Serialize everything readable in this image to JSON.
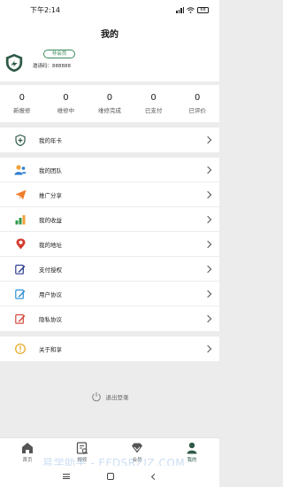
{
  "status_bar": {
    "time": "下午2:14",
    "battery": "68"
  },
  "header": {
    "title": "我的"
  },
  "profile": {
    "member_badge": "非会员",
    "invite_code": "邀请码：888888"
  },
  "stats": [
    {
      "value": "0",
      "label": "新报修"
    },
    {
      "value": "0",
      "label": "维修中"
    },
    {
      "value": "0",
      "label": "维修完成"
    },
    {
      "value": "0",
      "label": "已支付"
    },
    {
      "value": "0",
      "label": "已评价"
    }
  ],
  "menu": {
    "annual_card": "我的年卡",
    "team": "我的团队",
    "share": "推广分享",
    "income": "我的收益",
    "address": "我的地址",
    "payment_auth": "支付授权",
    "user_agreement": "用户协议",
    "privacy_policy": "隐私协议",
    "about": "关于和享"
  },
  "logout": {
    "label": "退出登录"
  },
  "tabbar": [
    {
      "label": "首页"
    },
    {
      "label": "报修"
    },
    {
      "label": "会员"
    },
    {
      "label": "我的"
    }
  ],
  "watermark": "易学助手 - EFDSRZJZ.COM",
  "colors": {
    "brand_green": "#2d5a46",
    "badge_green": "#3a8a5a",
    "page_bg": "#ececec"
  }
}
